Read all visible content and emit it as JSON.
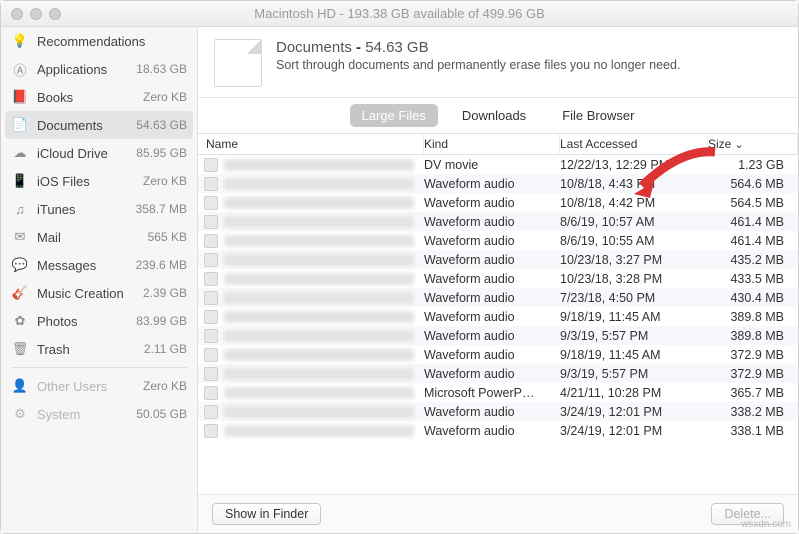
{
  "window": {
    "title": "Macintosh HD - 193.38 GB available of 499.96 GB"
  },
  "sidebar": {
    "items": [
      {
        "label": "Recommendations",
        "value": "",
        "icon": "lightbulb"
      },
      {
        "label": "Applications",
        "value": "18.63 GB",
        "icon": "app"
      },
      {
        "label": "Books",
        "value": "Zero KB",
        "icon": "book"
      },
      {
        "label": "Documents",
        "value": "54.63 GB",
        "icon": "doc",
        "selected": true
      },
      {
        "label": "iCloud Drive",
        "value": "85.95 GB",
        "icon": "cloud"
      },
      {
        "label": "iOS Files",
        "value": "Zero KB",
        "icon": "device"
      },
      {
        "label": "iTunes",
        "value": "358.7 MB",
        "icon": "music-note"
      },
      {
        "label": "Mail",
        "value": "565 KB",
        "icon": "mail"
      },
      {
        "label": "Messages",
        "value": "239.6 MB",
        "icon": "chat"
      },
      {
        "label": "Music Creation",
        "value": "2.39 GB",
        "icon": "guitar"
      },
      {
        "label": "Photos",
        "value": "83.99 GB",
        "icon": "flower"
      },
      {
        "label": "Trash",
        "value": "2.11 GB",
        "icon": "trash"
      }
    ],
    "other": [
      {
        "label": "Other Users",
        "value": "Zero KB",
        "icon": "user"
      },
      {
        "label": "System",
        "value": "50.05 GB",
        "icon": "gear"
      }
    ]
  },
  "header": {
    "title": "Documents",
    "size": "54.63 GB",
    "subtitle": "Sort through documents and permanently erase files you no longer need."
  },
  "tabs": [
    "Large Files",
    "Downloads",
    "File Browser"
  ],
  "columns": {
    "name": "Name",
    "kind": "Kind",
    "date": "Last Accessed",
    "size": "Size"
  },
  "rows": [
    {
      "kind": "DV movie",
      "date": "12/22/13, 12:29 PM",
      "size": "1.23 GB"
    },
    {
      "kind": "Waveform audio",
      "date": "10/8/18, 4:43 PM",
      "size": "564.6 MB"
    },
    {
      "kind": "Waveform audio",
      "date": "10/8/18, 4:42 PM",
      "size": "564.5 MB"
    },
    {
      "kind": "Waveform audio",
      "date": "8/6/19, 10:57 AM",
      "size": "461.4 MB"
    },
    {
      "kind": "Waveform audio",
      "date": "8/6/19, 10:55 AM",
      "size": "461.4 MB"
    },
    {
      "kind": "Waveform audio",
      "date": "10/23/18, 3:27 PM",
      "size": "435.2 MB"
    },
    {
      "kind": "Waveform audio",
      "date": "10/23/18, 3:28 PM",
      "size": "433.5 MB"
    },
    {
      "kind": "Waveform audio",
      "date": "7/23/18, 4:50 PM",
      "size": "430.4 MB"
    },
    {
      "kind": "Waveform audio",
      "date": "9/18/19, 11:45 AM",
      "size": "389.8 MB"
    },
    {
      "kind": "Waveform audio",
      "date": "9/3/19, 5:57 PM",
      "size": "389.8 MB"
    },
    {
      "kind": "Waveform audio",
      "date": "9/18/19, 11:45 AM",
      "size": "372.9 MB"
    },
    {
      "kind": "Waveform audio",
      "date": "9/3/19, 5:57 PM",
      "size": "372.9 MB"
    },
    {
      "kind": "Microsoft PowerP…",
      "date": "4/21/11, 10:28 PM",
      "size": "365.7 MB"
    },
    {
      "kind": "Waveform audio",
      "date": "3/24/19, 12:01 PM",
      "size": "338.2 MB"
    },
    {
      "kind": "Waveform audio",
      "date": "3/24/19, 12:01 PM",
      "size": "338.1 MB"
    }
  ],
  "footer": {
    "show": "Show in Finder",
    "delete": "Delete..."
  },
  "watermark": "wsxdn.com"
}
